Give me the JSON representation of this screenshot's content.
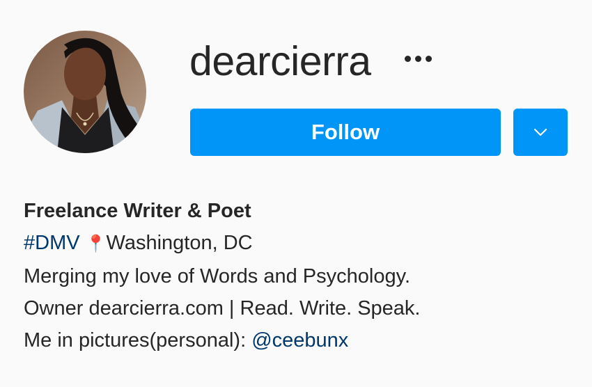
{
  "profile": {
    "username": "dearcierra",
    "more_icon": "more-horizontal-icon",
    "follow_label": "Follow",
    "dropdown_icon": "chevron-down-icon",
    "avatar_alt": "profile photo"
  },
  "bio": {
    "full_name": "Freelance Writer & Poet",
    "hashtag": "#DMV",
    "location_icon": "📍",
    "location": "Washington, DC",
    "line_3": "Merging my love of Words and Psychology.",
    "line_4": "Owner dearcierra.com | Read. Write. Speak.",
    "line_5_prefix": "Me in pictures(personal): ",
    "mention": "@ceebunx"
  },
  "colors": {
    "accent": "#0095f6",
    "link": "#00376b",
    "text": "#262626",
    "background": "#fafafa"
  }
}
